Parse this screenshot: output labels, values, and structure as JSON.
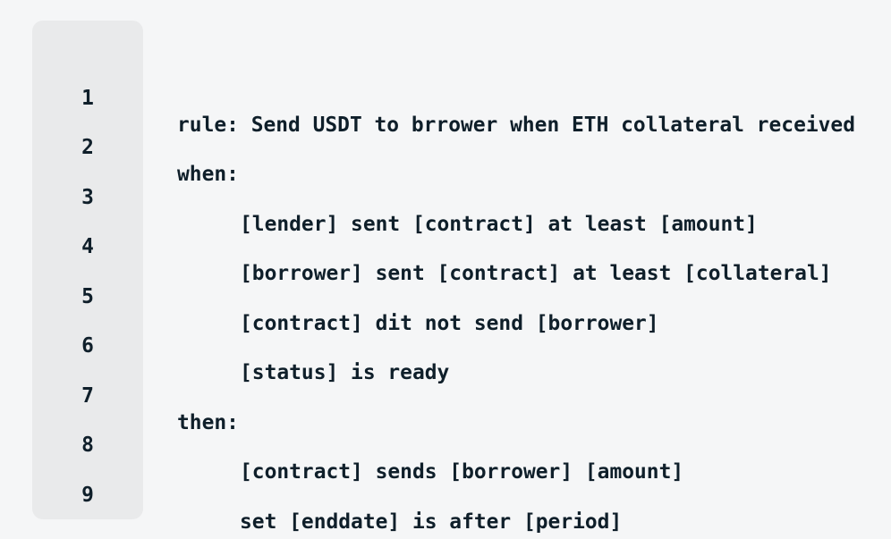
{
  "editor": {
    "lines": [
      {
        "number": "1",
        "indent": 0,
        "text": "rule: Send USDT to brrower when ETH collateral received"
      },
      {
        "number": "2",
        "indent": 0,
        "text": "when:"
      },
      {
        "number": "3",
        "indent": 1,
        "text": "[lender] sent [contract] at least [amount]"
      },
      {
        "number": "4",
        "indent": 1,
        "text": "[borrower] sent [contract] at least [collateral]"
      },
      {
        "number": "5",
        "indent": 1,
        "text": "[contract] dit not send [borrower]"
      },
      {
        "number": "6",
        "indent": 1,
        "text": "[status] is ready"
      },
      {
        "number": "7",
        "indent": 0,
        "text": "then:"
      },
      {
        "number": "8",
        "indent": 1,
        "text": "[contract] sends [borrower] [amount]"
      },
      {
        "number": "9",
        "indent": 1,
        "text": "set [enddate] is after [period]"
      }
    ]
  }
}
